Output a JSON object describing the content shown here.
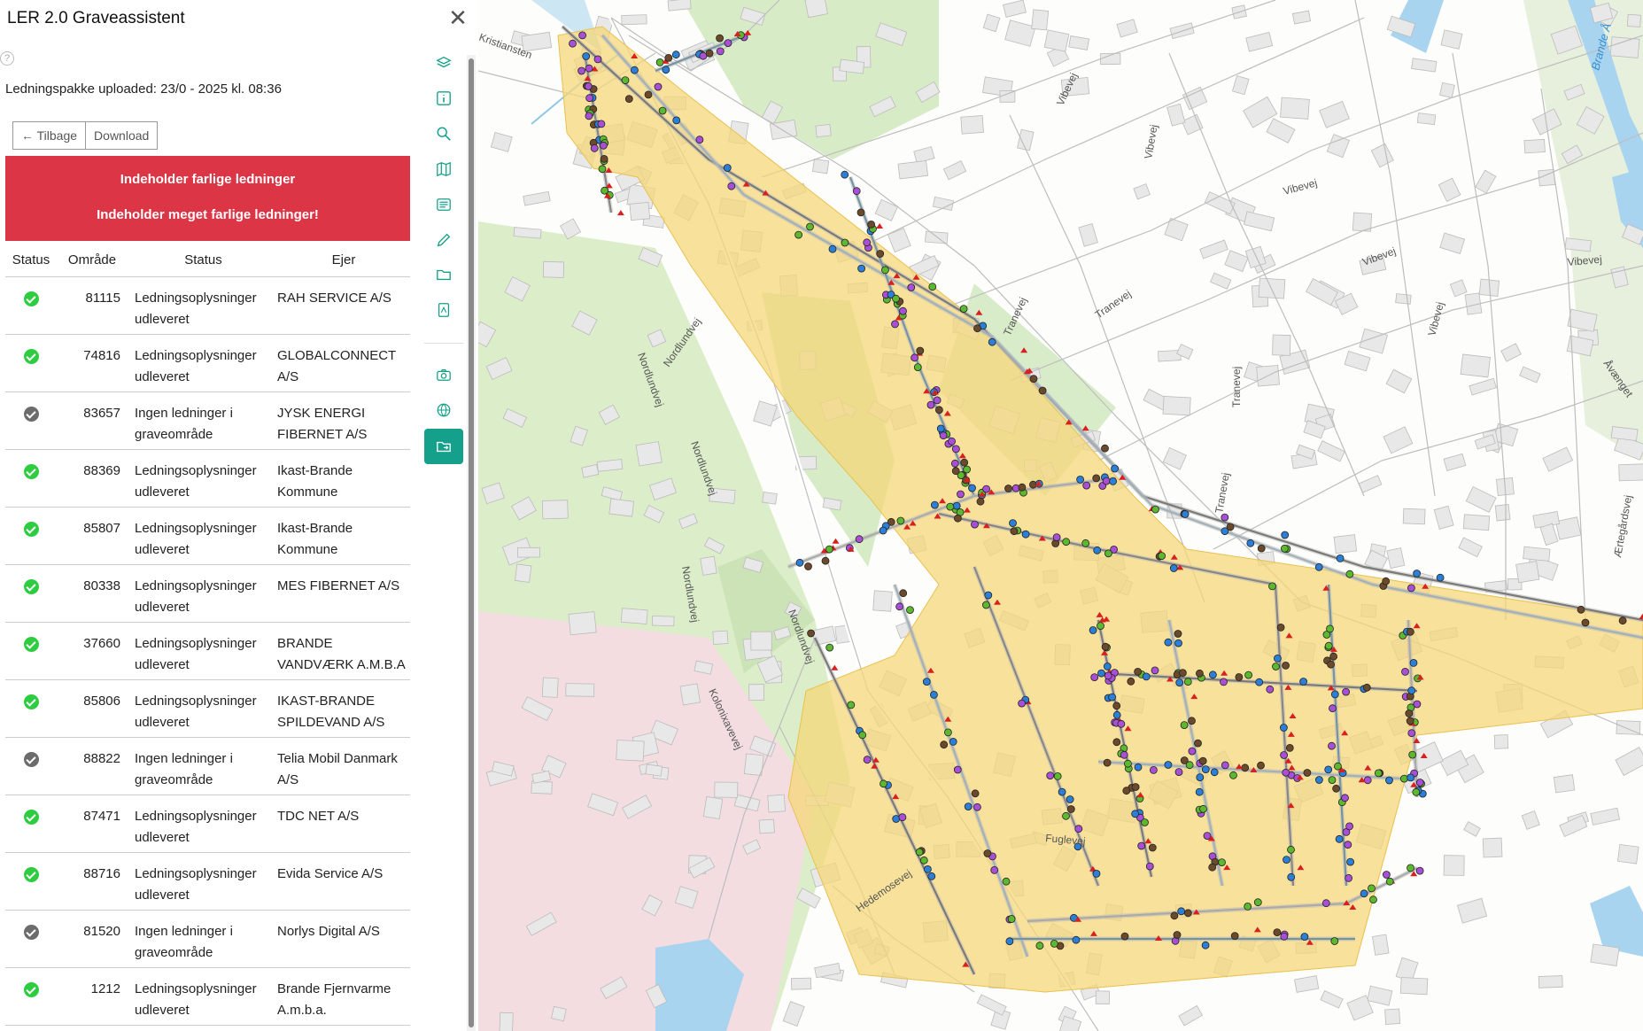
{
  "app": {
    "title": "LER 2.0 Graveassistent",
    "upload_text": "Ledningspakke uploaded: 23/0 - 2025 kl. 08:36",
    "back_button": "← Tilbage",
    "download_button": "Download",
    "warning_1": "Indeholder farlige ledninger",
    "warning_2": "Indeholder meget farlige ledninger!"
  },
  "table": {
    "headers": [
      "Status",
      "Område",
      "Status",
      "Ejer"
    ],
    "rows": [
      {
        "status": "ok",
        "area": "81115",
        "desc1": "Ledningsoplysninger",
        "desc2": "udleveret",
        "owner1": "RAH SERVICE A/S",
        "owner2": ""
      },
      {
        "status": "ok",
        "area": "74816",
        "desc1": "Ledningsoplysninger",
        "desc2": "udleveret",
        "owner1": "GLOBALCONNECT",
        "owner2": "A/S"
      },
      {
        "status": "none",
        "area": "83657",
        "desc1": "Ingen ledninger i",
        "desc2": "graveområde",
        "owner1": "JYSK ENERGI",
        "owner2": "FIBERNET A/S"
      },
      {
        "status": "ok",
        "area": "88369",
        "desc1": "Ledningsoplysninger",
        "desc2": "udleveret",
        "owner1": "Ikast-Brande",
        "owner2": "Kommune"
      },
      {
        "status": "ok",
        "area": "85807",
        "desc1": "Ledningsoplysninger",
        "desc2": "udleveret",
        "owner1": "Ikast-Brande",
        "owner2": "Kommune"
      },
      {
        "status": "ok",
        "area": "80338",
        "desc1": "Ledningsoplysninger",
        "desc2": "udleveret",
        "owner1": "MES FIBERNET A/S",
        "owner2": ""
      },
      {
        "status": "ok",
        "area": "37660",
        "desc1": "Ledningsoplysninger",
        "desc2": "udleveret",
        "owner1": "BRANDE",
        "owner2": "VANDVÆRK A.M.B.A"
      },
      {
        "status": "ok",
        "area": "85806",
        "desc1": "Ledningsoplysninger",
        "desc2": "udleveret",
        "owner1": "IKAST-BRANDE",
        "owner2": "SPILDEVAND A/S"
      },
      {
        "status": "none",
        "area": "88822",
        "desc1": "Ingen ledninger i",
        "desc2": "graveområde",
        "owner1": "Telia Mobil Danmark",
        "owner2": "A/S"
      },
      {
        "status": "ok",
        "area": "87471",
        "desc1": "Ledningsoplysninger",
        "desc2": "udleveret",
        "owner1": "TDC NET A/S",
        "owner2": ""
      },
      {
        "status": "ok",
        "area": "88716",
        "desc1": "Ledningsoplysninger",
        "desc2": "udleveret",
        "owner1": "Evida Service A/S",
        "owner2": ""
      },
      {
        "status": "none",
        "area": "81520",
        "desc1": "Ingen ledninger i",
        "desc2": "graveområde",
        "owner1": "Norlys Digital A/S",
        "owner2": ""
      },
      {
        "status": "ok",
        "area": "1212",
        "desc1": "Ledningsoplysninger",
        "desc2": "udleveret",
        "owner1": "Brande Fjernvarme",
        "owner2": "A.m.b.a."
      }
    ]
  },
  "toolbar": [
    "layers-icon",
    "info-icon",
    "search-icon",
    "map-icon",
    "list-icon",
    "pencil-icon",
    "folder-icon",
    "pdf-icon",
    "camera-icon",
    "globe-icon",
    "export-icon"
  ],
  "map": {
    "streets": [
      "Vibevej",
      "Vibevej",
      "Vibevej",
      "Vibevej",
      "Vibevej",
      "Vibevej",
      "Tranevej",
      "Tranevej",
      "Tranevej",
      "Tranevej",
      "Nordlundvej",
      "Nordlundvej",
      "Nordlundvej",
      "Nordlundvej",
      "Nordlundvej",
      "Koloniхavevej",
      "Hedemosevej",
      "Fuglevej",
      "Åvænget",
      "Ærtegårdsvej",
      "Kristiansten"
    ],
    "river": "Brande Å"
  },
  "colors": {
    "danger": "#dc3545",
    "ok": "#2ecc40",
    "none": "#6c6c6c",
    "accent": "#14a08a",
    "area_fill": "#f6d77a"
  }
}
